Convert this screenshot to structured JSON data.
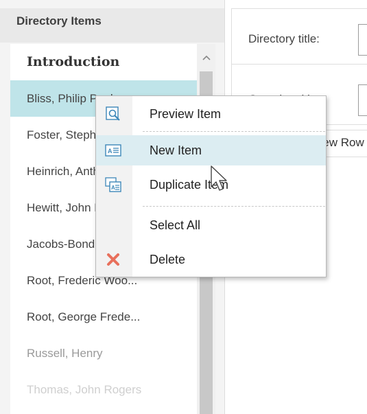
{
  "panel": {
    "header": "Directory Items",
    "items": [
      {
        "label": "Introduction"
      },
      {
        "label": "Bliss, Philip Paul"
      },
      {
        "label": "Foster, Stephen"
      },
      {
        "label": "Heinrich, Anthony"
      },
      {
        "label": "Hewitt, John Hill"
      },
      {
        "label": "Jacobs-Bond, Carrie"
      },
      {
        "label": "Root, Frederic Woo..."
      },
      {
        "label": "Root, George Frede..."
      },
      {
        "label": "Russell, Henry"
      },
      {
        "label": "Thomas, John Rogers"
      }
    ]
  },
  "form": {
    "directory_title_label": "Directory title:",
    "question_title_label": "Question title:",
    "new_row_label": "New Row"
  },
  "menu": {
    "items": [
      {
        "label": "Preview Item",
        "icon": "preview-icon"
      },
      {
        "label": "New Item",
        "icon": "new-item-icon"
      },
      {
        "label": "Duplicate Item",
        "icon": "duplicate-icon"
      },
      {
        "label": "Select All",
        "icon": ""
      },
      {
        "label": "Delete",
        "icon": "delete-icon"
      }
    ],
    "accent": "#dcedf2",
    "delete_color": "#e8705c",
    "icon_color": "#3d87b8"
  },
  "colors": {
    "selected_row": "#bfe4e9"
  }
}
